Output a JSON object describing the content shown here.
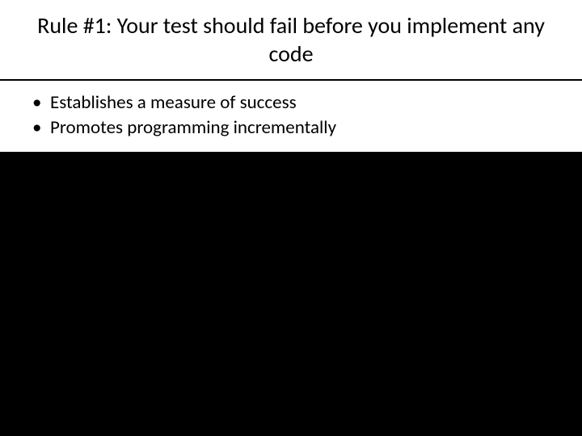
{
  "slide": {
    "title": "Rule #1: Your test should fail before you implement any code",
    "bullets": [
      "Establishes a measure of success",
      "Promotes programming incrementally"
    ]
  }
}
